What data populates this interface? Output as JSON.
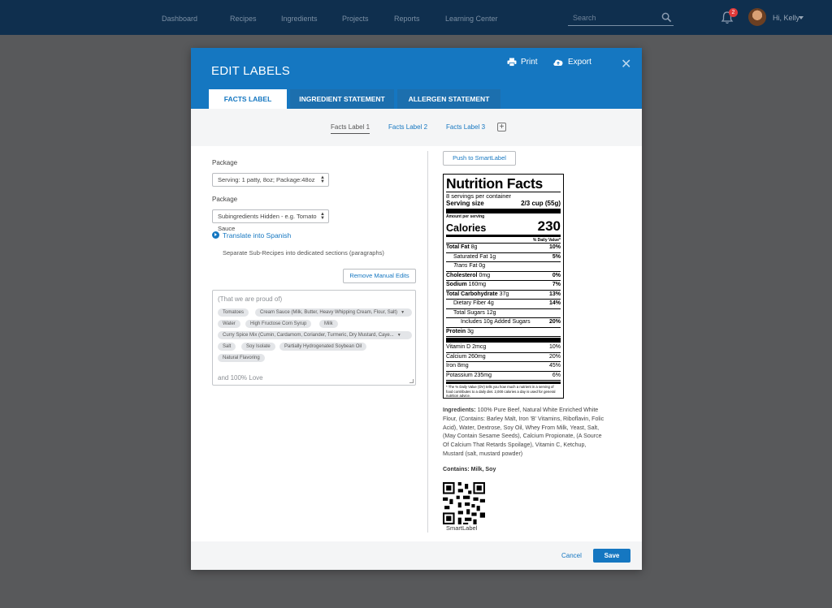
{
  "topnav": {
    "items": [
      "Dashboard",
      "Recipes",
      "Ingredients",
      "Projects",
      "Reports",
      "Learning Center"
    ],
    "search_placeholder": "Search",
    "notification_count": "2",
    "user_greeting": "Hi, Kelly"
  },
  "modal": {
    "title": "EDIT LABELS",
    "print_label": "Print",
    "export_label": "Export",
    "close_label": "✕",
    "tabs": [
      "FACTS LABEL",
      "INGREDIENT STATEMENT",
      "ALLERGEN STATEMENT"
    ],
    "active_tab": "FACTS LABEL",
    "subtabs": [
      "Facts Label 1",
      "Facts Label 2",
      "Facts Label 3"
    ],
    "add_subtab": "+"
  },
  "left": {
    "package_label_1": "Package",
    "package_value_1": "Serving: 1 patty, 8oz; Package:48oz",
    "package_label_2": "Package",
    "package_value_2": "Subingredients Hidden - e.g. Tomato Sauce",
    "translate_label": "Translate into Spanish",
    "separate_text": "Separate Sub-Recipes into dedicated sections (paragraphs)",
    "remove_edits_label": "Remove Manual Edits",
    "editor": {
      "prefix": "(That we are proud of)",
      "chips": [
        [
          "Tomatoes",
          "Cream Sauce (Milk, Butter, Heavy Whipping Cream, Flour, Salt)"
        ],
        [
          "Water",
          "High Fructose Corn Syrup",
          "Milk"
        ],
        [
          "Curry Spice Mix (Cumin, Cardamom, Coriander, Turmeric, Dry Mustard, Caye..."
        ],
        [
          "Salt",
          "Soy Isolate",
          "Partially Hydrogenated Soybean Oil"
        ],
        [
          "Natural Flavoring"
        ]
      ],
      "suffix": "and 100% Love"
    }
  },
  "right": {
    "push_label": "Push to SmartLabel",
    "nutrition": {
      "title": "Nutrition Facts",
      "servings": "8 servings per container",
      "serving_size_label": "Serving size",
      "serving_size_value": "2/3 cup (55g)",
      "amount_per_serving": "Amount per serving",
      "calories_label": "Calories",
      "calories_value": "230",
      "dv_header": "% Daily Value*",
      "rows": [
        {
          "label": "Total Fat",
          "amount": "8g",
          "dv": "10%",
          "bold": true,
          "indent": 0
        },
        {
          "label": "Saturated Fat",
          "amount": "1g",
          "dv": "5%",
          "bold": false,
          "indent": 1
        },
        {
          "label": "Trans",
          "amount": "Fat 0g",
          "dv": "",
          "bold": false,
          "indent": 1,
          "italic": true
        },
        {
          "label": "Cholesterol",
          "amount": "0mg",
          "dv": "0%",
          "bold": true,
          "indent": 0
        },
        {
          "label": "Sodium",
          "amount": "160mg",
          "dv": "7%",
          "bold": true,
          "indent": 0
        },
        {
          "label": "Total Carbohydrate",
          "amount": "37g",
          "dv": "13%",
          "bold": true,
          "indent": 0
        },
        {
          "label": "Dietary Fiber",
          "amount": "4g",
          "dv": "14%",
          "bold": false,
          "indent": 1
        },
        {
          "label": "Total Sugars",
          "amount": "12g",
          "dv": "",
          "bold": false,
          "indent": 1
        },
        {
          "label": "Includes 10g Added Sugars",
          "amount": "",
          "dv": "20%",
          "bold": false,
          "indent": 2
        },
        {
          "label": "Protein",
          "amount": "3g",
          "dv": "",
          "bold": true,
          "indent": 0
        }
      ],
      "vitamins": [
        {
          "label": "Vitamin D 2mcg",
          "dv": "10%"
        },
        {
          "label": "Calcium 260mg",
          "dv": "20%"
        },
        {
          "label": "Iron 8mg",
          "dv": "45%"
        },
        {
          "label": "Potassium 235mg",
          "dv": "6%"
        }
      ],
      "footnote": "* The % Daily Value (DV) tells you how much a nutrient in a serving of food contributes to a daily diet. 2,000 calories a day is used for general nutrition advice."
    },
    "ingredients_heading": "Ingredients:",
    "ingredients_text": "100% Pure Beef, Natural White Enriched White Flour, (Contains: Barley Malt, Iron 'B' Vitamins, Riboflavin, Folic Acid), Water, Dextrose, Soy Oil, Whey From Milk, Yeast, Salt, (May Contain Sesame Seeds), Calcium Propionate, (A Source Of Calcium That Retards Spoilage), Vitamin C, Ketchup, Mustard (salt, mustard powder)",
    "contains_text": "Contains: Milk, Soy",
    "smartlabel_caption": "SmartLabel"
  },
  "footer": {
    "cancel_label": "Cancel",
    "save_label": "Save"
  },
  "colors": {
    "topbar": "#0f2f4e",
    "header_blue": "#1577c1",
    "overlay": "#58595b"
  }
}
